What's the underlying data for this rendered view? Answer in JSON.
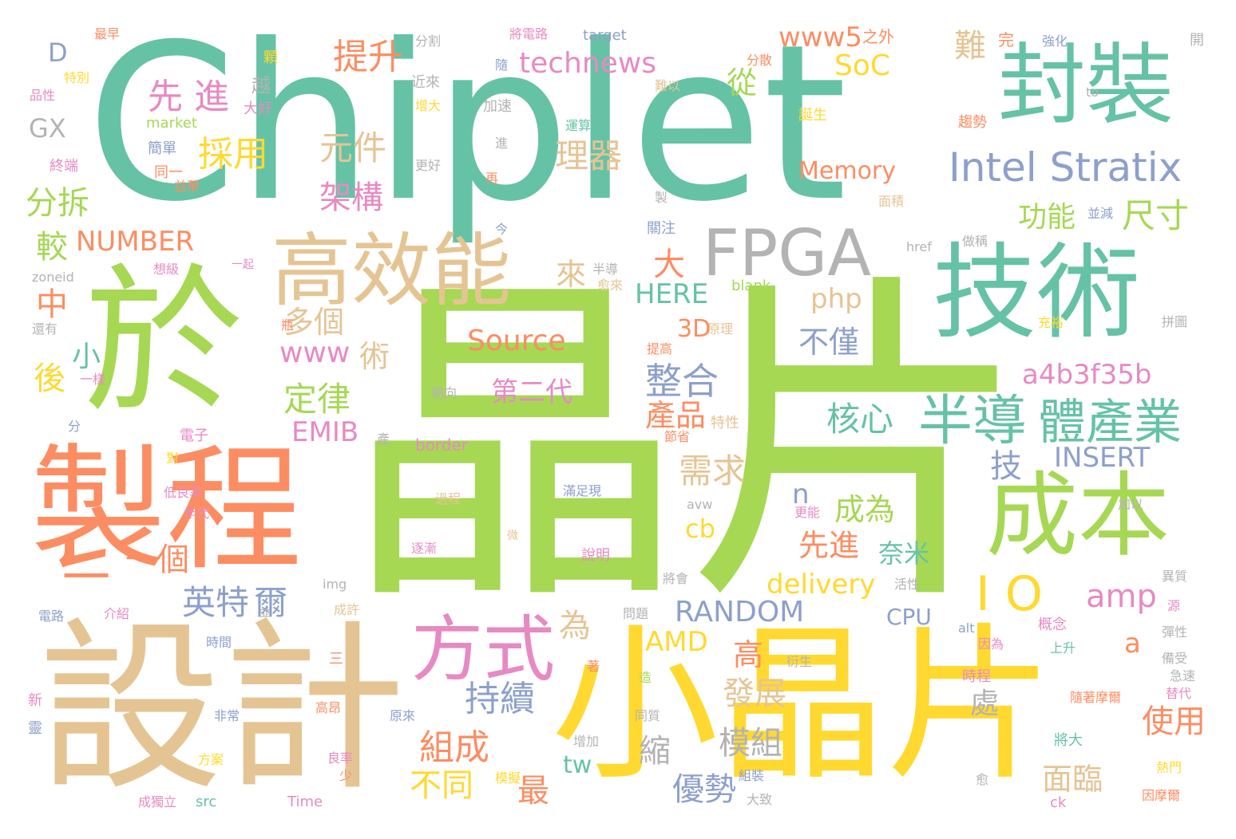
{
  "palette": {
    "teal": "#66c2a5",
    "green": "#a6d854",
    "orange": "#fc8d62",
    "tan": "#e5c494",
    "yellow": "#ffd92f",
    "pink": "#e78ac3",
    "blue": "#8da0cb",
    "gray": "#b3b3b3"
  },
  "words": [
    {
      "text": "Chiplet",
      "color": "teal"
    },
    {
      "text": "晶片",
      "color": "green"
    },
    {
      "text": "設計",
      "color": "tan"
    },
    {
      "text": "小晶片",
      "color": "yellow"
    },
    {
      "text": "製程",
      "color": "orange"
    },
    {
      "text": "於",
      "color": "green"
    },
    {
      "text": "封裝",
      "color": "teal"
    },
    {
      "text": "技術",
      "color": "teal"
    },
    {
      "text": "成本",
      "color": "green"
    },
    {
      "text": "高效能",
      "color": "tan"
    },
    {
      "text": "FPGA",
      "color": "gray"
    },
    {
      "text": "方式",
      "color": "pink"
    },
    {
      "text": "一",
      "color": "orange"
    },
    {
      "text": "半導",
      "color": "teal"
    },
    {
      "text": "體產業",
      "color": "teal"
    },
    {
      "text": "Intel Stratix",
      "color": "blue"
    },
    {
      "text": "提升",
      "color": "orange"
    },
    {
      "text": "先 進",
      "color": "pink"
    },
    {
      "text": "採用",
      "color": "yellow"
    },
    {
      "text": "technews",
      "color": "pink"
    },
    {
      "text": "www5",
      "color": "orange"
    },
    {
      "text": "SoC",
      "color": "yellow"
    },
    {
      "text": "從",
      "color": "green"
    },
    {
      "text": "難",
      "color": "tan"
    },
    {
      "text": "元件",
      "color": "tan"
    },
    {
      "text": "理器",
      "color": "tan"
    },
    {
      "text": "架構",
      "color": "pink"
    },
    {
      "text": "分拆",
      "color": "green"
    },
    {
      "text": "NUMBER",
      "color": "orange"
    },
    {
      "text": "較",
      "color": "green"
    },
    {
      "text": "中",
      "color": "orange"
    },
    {
      "text": "功能",
      "color": "green"
    },
    {
      "text": "尺寸",
      "color": "green"
    },
    {
      "text": "Memory",
      "color": "orange"
    },
    {
      "text": "大",
      "color": "orange"
    },
    {
      "text": "來",
      "color": "tan"
    },
    {
      "text": "php",
      "color": "tan"
    },
    {
      "text": "HERE",
      "color": "teal"
    },
    {
      "text": "多個",
      "color": "tan"
    },
    {
      "text": "3D",
      "color": "orange"
    },
    {
      "text": "Source",
      "color": "orange"
    },
    {
      "text": "www",
      "color": "pink"
    },
    {
      "text": "術",
      "color": "tan"
    },
    {
      "text": "不僅",
      "color": "blue"
    },
    {
      "text": "a4b3f35b",
      "color": "pink"
    },
    {
      "text": "整合",
      "color": "blue"
    },
    {
      "text": "定律",
      "color": "green"
    },
    {
      "text": "第二代",
      "color": "pink"
    },
    {
      "text": "產品",
      "color": "orange"
    },
    {
      "text": "核心",
      "color": "teal"
    },
    {
      "text": "EMIB",
      "color": "pink"
    },
    {
      "text": "INSERT",
      "color": "blue"
    },
    {
      "text": "技",
      "color": "blue"
    },
    {
      "text": "需求",
      "color": "tan"
    },
    {
      "text": "成為",
      "color": "green"
    },
    {
      "text": "n",
      "color": "blue"
    },
    {
      "text": "cb",
      "color": "yellow"
    },
    {
      "text": "一個",
      "color": "orange"
    },
    {
      "text": "先進",
      "color": "orange"
    },
    {
      "text": "奈米",
      "color": "teal"
    },
    {
      "text": "delivery",
      "color": "yellow"
    },
    {
      "text": "英特",
      "color": "blue"
    },
    {
      "text": "爾",
      "color": "blue"
    },
    {
      "text": "RANDOM",
      "color": "blue"
    },
    {
      "text": "I O",
      "color": "yellow"
    },
    {
      "text": "amp",
      "color": "pink"
    },
    {
      "text": "為",
      "color": "tan"
    },
    {
      "text": "AMD",
      "color": "yellow"
    },
    {
      "text": "CPU",
      "color": "blue"
    },
    {
      "text": "高",
      "color": "orange"
    },
    {
      "text": "a",
      "color": "orange"
    },
    {
      "text": "持續",
      "color": "blue"
    },
    {
      "text": "發展",
      "color": "tan"
    },
    {
      "text": "處",
      "color": "gray"
    },
    {
      "text": "使用",
      "color": "orange"
    },
    {
      "text": "組成",
      "color": "orange"
    },
    {
      "text": "縮",
      "color": "gray"
    },
    {
      "text": "模組",
      "color": "gray"
    },
    {
      "text": "tw",
      "color": "teal"
    },
    {
      "text": "不同",
      "color": "yellow"
    },
    {
      "text": "最",
      "color": "orange"
    },
    {
      "text": "優勢",
      "color": "blue"
    },
    {
      "text": "面臨",
      "color": "tan"
    },
    {
      "text": "D",
      "color": "blue"
    },
    {
      "text": "GX",
      "color": "gray"
    },
    {
      "text": "小",
      "color": "teal"
    },
    {
      "text": "後",
      "color": "yellow"
    },
    {
      "text": "越",
      "color": "gray"
    },
    {
      "text": "最早",
      "color": "orange"
    },
    {
      "text": "分割",
      "color": "gray"
    },
    {
      "text": "將電路",
      "color": "pink"
    },
    {
      "text": "target",
      "color": "blue"
    },
    {
      "text": "之外",
      "color": "orange"
    },
    {
      "text": "完",
      "color": "orange"
    },
    {
      "text": "強化",
      "color": "blue"
    },
    {
      "text": "開",
      "color": "gray"
    },
    {
      "text": "顆",
      "color": "yellow"
    },
    {
      "text": "隨",
      "color": "blue"
    },
    {
      "text": "近來",
      "color": "gray"
    },
    {
      "text": "分散",
      "color": "orange"
    },
    {
      "text": "品性",
      "color": "pink"
    },
    {
      "text": "特別",
      "color": "yellow"
    },
    {
      "text": "大好",
      "color": "pink"
    },
    {
      "text": "增大",
      "color": "yellow"
    },
    {
      "text": "加速",
      "color": "gray"
    },
    {
      "text": "難以",
      "color": "tan"
    },
    {
      "text": "to",
      "color": "gray"
    },
    {
      "text": "market",
      "color": "green"
    },
    {
      "text": "運算處",
      "color": "teal"
    },
    {
      "text": "誕生",
      "color": "yellow"
    },
    {
      "text": "趨勢",
      "color": "orange"
    },
    {
      "text": "簡單",
      "color": "blue"
    },
    {
      "text": "進",
      "color": "gray"
    },
    {
      "text": "同一",
      "color": "orange"
    },
    {
      "text": "更好",
      "color": "gray"
    },
    {
      "text": "終端",
      "color": "pink"
    },
    {
      "text": "益華",
      "color": "orange"
    },
    {
      "text": "再",
      "color": "orange"
    },
    {
      "text": "製",
      "color": "gray"
    },
    {
      "text": "面積",
      "color": "tan"
    },
    {
      "text": "並減",
      "color": "blue"
    },
    {
      "text": "關注",
      "color": "blue"
    },
    {
      "text": "今",
      "color": "blue"
    },
    {
      "text": "半導",
      "color": "gray"
    },
    {
      "text": "href",
      "color": "gray"
    },
    {
      "text": "做稱",
      "color": "gray"
    },
    {
      "text": "一起",
      "color": "pink"
    },
    {
      "text": "zoneid",
      "color": "gray"
    },
    {
      "text": "想級",
      "color": "pink"
    },
    {
      "text": "愈來",
      "color": "tan"
    },
    {
      "text": "blank",
      "color": "green"
    },
    {
      "text": "還有",
      "color": "gray"
    },
    {
      "text": "瓶",
      "color": "orange"
    },
    {
      "text": "提高",
      "color": "orange"
    },
    {
      "text": "原理",
      "color": "tan"
    },
    {
      "text": "充裕",
      "color": "yellow"
    },
    {
      "text": "拼圖",
      "color": "gray"
    },
    {
      "text": "一樣",
      "color": "pink"
    },
    {
      "text": "朝向",
      "color": "gray"
    },
    {
      "text": "分",
      "color": "blue"
    },
    {
      "text": "電子",
      "color": "pink"
    },
    {
      "text": "特性",
      "color": "tan"
    },
    {
      "text": "節省",
      "color": "orange"
    },
    {
      "text": "border",
      "color": "pink"
    },
    {
      "text": "產",
      "color": "gray"
    },
    {
      "text": "對",
      "color": "yellow"
    },
    {
      "text": "低良率",
      "color": "pink"
    },
    {
      "text": "年代",
      "color": "pink"
    },
    {
      "text": "過程",
      "color": "tan"
    },
    {
      "text": "滿足現",
      "color": "blue"
    },
    {
      "text": "avw",
      "color": "gray"
    },
    {
      "text": "更能",
      "color": "pink"
    },
    {
      "text": "加以",
      "color": "gray"
    },
    {
      "text": "逐漸",
      "color": "pink"
    },
    {
      "text": "微",
      "color": "tan"
    },
    {
      "text": "說明",
      "color": "pink"
    },
    {
      "text": "將會",
      "color": "gray"
    },
    {
      "text": "img",
      "color": "gray"
    },
    {
      "text": "活性",
      "color": "gray"
    },
    {
      "text": "異質",
      "color": "gray"
    },
    {
      "text": "電路",
      "color": "blue"
    },
    {
      "text": "介紹",
      "color": "pink"
    },
    {
      "text": "並",
      "color": "gray"
    },
    {
      "text": "成許",
      "color": "tan"
    },
    {
      "text": "問題",
      "color": "gray"
    },
    {
      "text": "alt",
      "color": "blue"
    },
    {
      "text": "概念",
      "color": "pink"
    },
    {
      "text": "源",
      "color": "pink"
    },
    {
      "text": "因為",
      "color": "pink"
    },
    {
      "text": "彈性",
      "color": "gray"
    },
    {
      "text": "時間",
      "color": "blue"
    },
    {
      "text": "三",
      "color": "orange"
    },
    {
      "text": "衍生",
      "color": "gray"
    },
    {
      "text": "上升",
      "color": "teal"
    },
    {
      "text": "備受",
      "color": "gray"
    },
    {
      "text": "著",
      "color": "orange"
    },
    {
      "text": "造",
      "color": "green"
    },
    {
      "text": "時程",
      "color": "pink"
    },
    {
      "text": "急速",
      "color": "gray"
    },
    {
      "text": "新",
      "color": "pink"
    },
    {
      "text": "非常",
      "color": "blue"
    },
    {
      "text": "高昂",
      "color": "orange"
    },
    {
      "text": "原來",
      "color": "blue"
    },
    {
      "text": "同質",
      "color": "gray"
    },
    {
      "text": "隨著摩爾",
      "color": "orange"
    },
    {
      "text": "替代",
      "color": "pink"
    },
    {
      "text": "靈",
      "color": "blue"
    },
    {
      "text": "增加",
      "color": "gray"
    },
    {
      "text": "將大",
      "color": "teal"
    },
    {
      "text": "方案",
      "color": "yellow"
    },
    {
      "text": "良率",
      "color": "pink"
    },
    {
      "text": "少",
      "color": "orange"
    },
    {
      "text": "熱門",
      "color": "yellow"
    },
    {
      "text": "組裝",
      "color": "blue"
    },
    {
      "text": "愈",
      "color": "gray"
    },
    {
      "text": "模擬",
      "color": "yellow"
    },
    {
      "text": "成獨立",
      "color": "pink"
    },
    {
      "text": "src",
      "color": "teal"
    },
    {
      "text": "Time",
      "color": "pink"
    },
    {
      "text": "大致",
      "color": "gray"
    },
    {
      "text": "ck",
      "color": "pink"
    },
    {
      "text": "因摩爾",
      "color": "orange"
    }
  ]
}
